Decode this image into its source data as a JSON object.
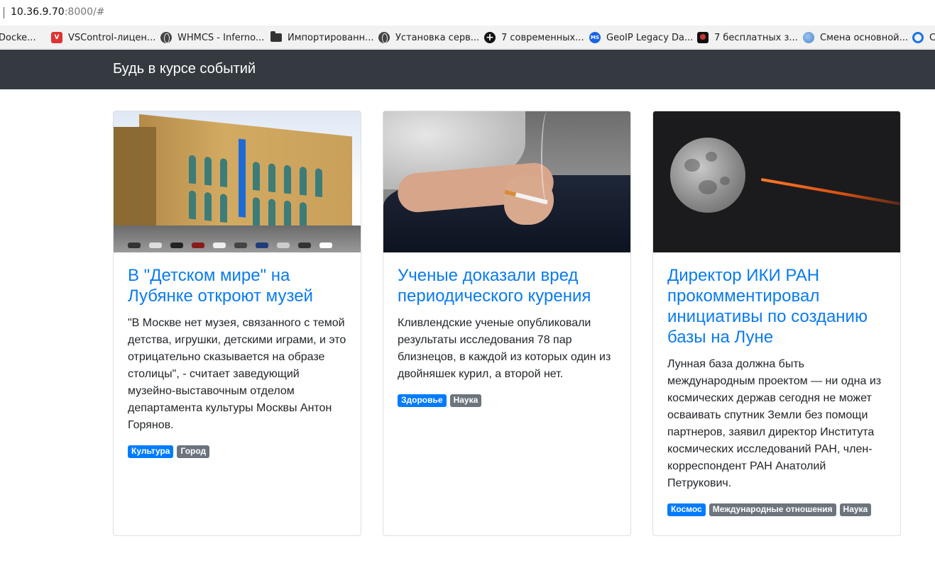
{
  "browser": {
    "url_host": "10.36.9.70",
    "url_rest": ":8000/#",
    "bookmarks": [
      {
        "label": "Docke...",
        "icon": "docker-icon"
      },
      {
        "label": "VSControl-лицен...",
        "icon": "vscontrol-icon"
      },
      {
        "label": "WHMCS - Inferno...",
        "icon": "globe-icon"
      },
      {
        "label": "Импортированн...",
        "icon": "folder-icon"
      },
      {
        "label": "Установка серв...",
        "icon": "globe-icon"
      },
      {
        "label": "7 современных...",
        "icon": "plus-circle-icon"
      },
      {
        "label": "GeoIP Legacy Da...",
        "icon": "ms-icon"
      },
      {
        "label": "7 бесплатных з...",
        "icon": "app-icon"
      },
      {
        "label": "Смена основной...",
        "icon": "swirl-icon"
      },
      {
        "label": "С",
        "icon": "circle-icon"
      }
    ]
  },
  "navbar": {
    "brand": "Будь в курсе событий"
  },
  "cards": [
    {
      "title": "В \"Детском мире\" на Лубянке откроют музей",
      "text": "\"В Москве нет музея, связанного с темой детства, игрушки, детскими играми, и это отрицательно сказывается на образе столицы\", - считает заведующий музейно-выставочным отделом департамента культуры Москвы Антон Горянов.",
      "tags": [
        "Культура",
        "Город"
      ]
    },
    {
      "title": "Ученые доказали вред периодического курения",
      "text": "Кливлендские ученые опубликовали результаты исследования 78 пар близнецов, в каждой из которых один из двойняшек курил, а второй нет.",
      "tags": [
        "Здоровье",
        "Наука"
      ]
    },
    {
      "title": "Директор ИКИ РАН прокомментировал инициативы по созданию базы на Луне",
      "text": "Лунная база должна быть международным проектом — ни одна из космических держав сегодня не может осваивать спутник Земли без помощи партнеров, заявил директор Института космических исследований РАН, член-корреспондент РАН Анатолий Петрукович.",
      "tags": [
        "Космос",
        "Международные отношения",
        "Наука"
      ]
    }
  ],
  "colors": {
    "navbar_bg": "#343a40",
    "link": "#0a7bf0",
    "badge_primary": "#007bff",
    "badge_secondary": "#6c757d"
  }
}
